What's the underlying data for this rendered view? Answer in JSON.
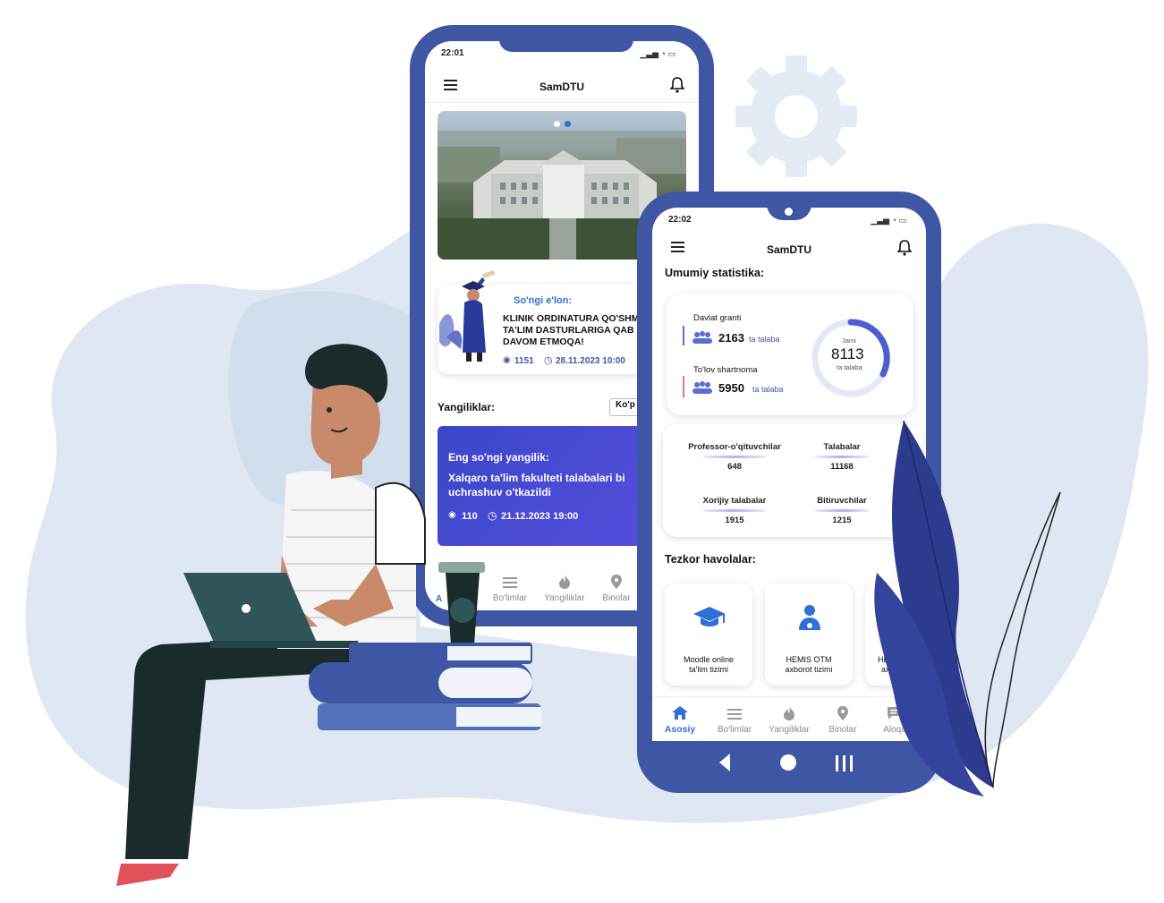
{
  "phone_back": {
    "status_time": "22:01",
    "app_title": "SamDTU",
    "announcement": {
      "label": "So'ngi e'lon:",
      "title_line1": "KLINIK ORDINATURA QO'SHM",
      "title_line2": "TA'LIM DASTURLARIGA QAB",
      "title_line3": "DAVOM ETMOQA!",
      "views": "1151",
      "date": "28.11.2023 10:00"
    },
    "news_heading": "Yangiliklar:",
    "more_button": "Ko'p",
    "latest_news": {
      "label": "Eng so'ngi yangilik:",
      "title_line1": "Xalqaro ta'lim fakulteti talabalari bi",
      "title_line2": "uchrashuv o'tkazildi",
      "views": "110",
      "date": "21.12.2023 19:00"
    },
    "nav": [
      "A",
      "Bo'limlar",
      "Yangiliklar",
      "Binolar"
    ]
  },
  "phone_front": {
    "status_time": "22:02",
    "app_title": "SamDTU",
    "stats_heading": "Umumiy statistika:",
    "grant": {
      "label": "Davlat granti",
      "value": "2163",
      "unit": "ta talaba"
    },
    "contract": {
      "label": "To'lov shartnoma",
      "value": "5950",
      "unit": "ta talaba"
    },
    "total": {
      "top": "Jami",
      "value": "8113",
      "bottom": "ta talaba"
    },
    "counts": [
      {
        "label": "Professor-o'qituvchilar",
        "value": "648"
      },
      {
        "label": "Talabalar",
        "value": "11168"
      },
      {
        "label": "Xorijiy talabalar",
        "value": "1915"
      },
      {
        "label": "Bitiruvchilar",
        "value": "1215"
      }
    ],
    "quick_heading": "Tezkor havolalar:",
    "quick_links": [
      {
        "line1": "Moodle online",
        "line2": "ta'lim tizimi",
        "icon": "graduation-cap-icon"
      },
      {
        "line1": "HEMIS OTM",
        "line2": "axborot tizimi",
        "icon": "doctor-icon"
      },
      {
        "line1": "HEM",
        "line2": "axb",
        "icon": "users-icon"
      }
    ],
    "nav": [
      "Asosiy",
      "Bo'limlar",
      "Yangiliklar",
      "Binolar",
      "Aloqa"
    ]
  },
  "colors": {
    "primary": "#3f56a5",
    "accent": "#2f6fd8",
    "news_gradient_start": "#3a47c9",
    "news_gradient_end": "#5a4ee0"
  }
}
